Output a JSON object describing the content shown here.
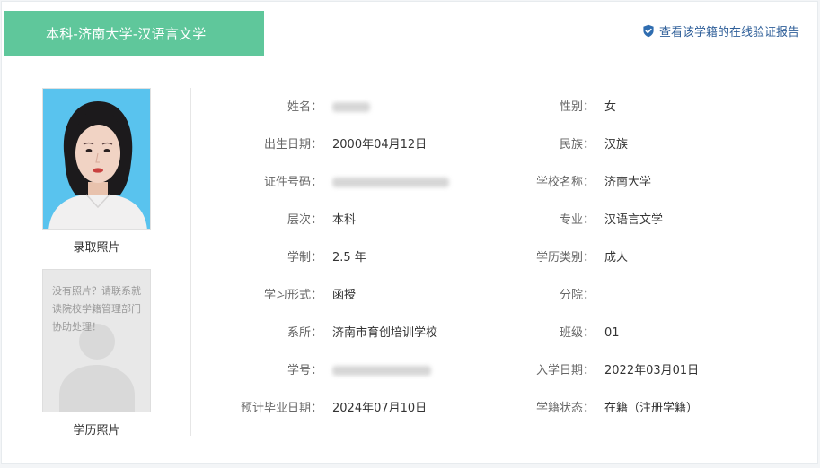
{
  "header": {
    "title": "本科-济南大学-汉语言文学",
    "title_bg": "#5fc79b",
    "verify_link": "查看该学籍的在线验证报告",
    "verify_color": "#2f5f99"
  },
  "photos": {
    "admission_caption": "录取照片",
    "degree_caption": "学历照片",
    "placeholder_text": "没有照片？请联系就读院校学籍管理部门协助处理！"
  },
  "left_fields": [
    {
      "label": "姓名：",
      "value": null,
      "blurred": true
    },
    {
      "label": "出生日期：",
      "value": "2000年04月12日"
    },
    {
      "label": "证件号码：",
      "value": null,
      "blurred": true
    },
    {
      "label": "层次：",
      "value": "本科"
    },
    {
      "label": "学制：",
      "value": "2.5 年"
    },
    {
      "label": "学习形式：",
      "value": "函授"
    },
    {
      "label": "系所：",
      "value": "济南市育创培训学校"
    },
    {
      "label": "学号：",
      "value": null,
      "blurred": true
    },
    {
      "label": "预计毕业日期：",
      "value": "2024年07月10日"
    }
  ],
  "right_fields": [
    {
      "label": "性别：",
      "value": "女"
    },
    {
      "label": "民族：",
      "value": "汉族"
    },
    {
      "label": "学校名称：",
      "value": "济南大学"
    },
    {
      "label": "专业：",
      "value": "汉语言文学"
    },
    {
      "label": "学历类别：",
      "value": "成人"
    },
    {
      "label": "分院：",
      "value": ""
    },
    {
      "label": "班级：",
      "value": "01"
    },
    {
      "label": "入学日期：",
      "value": "2022年03月01日"
    },
    {
      "label": "学籍状态：",
      "value": "在籍（注册学籍）"
    }
  ]
}
